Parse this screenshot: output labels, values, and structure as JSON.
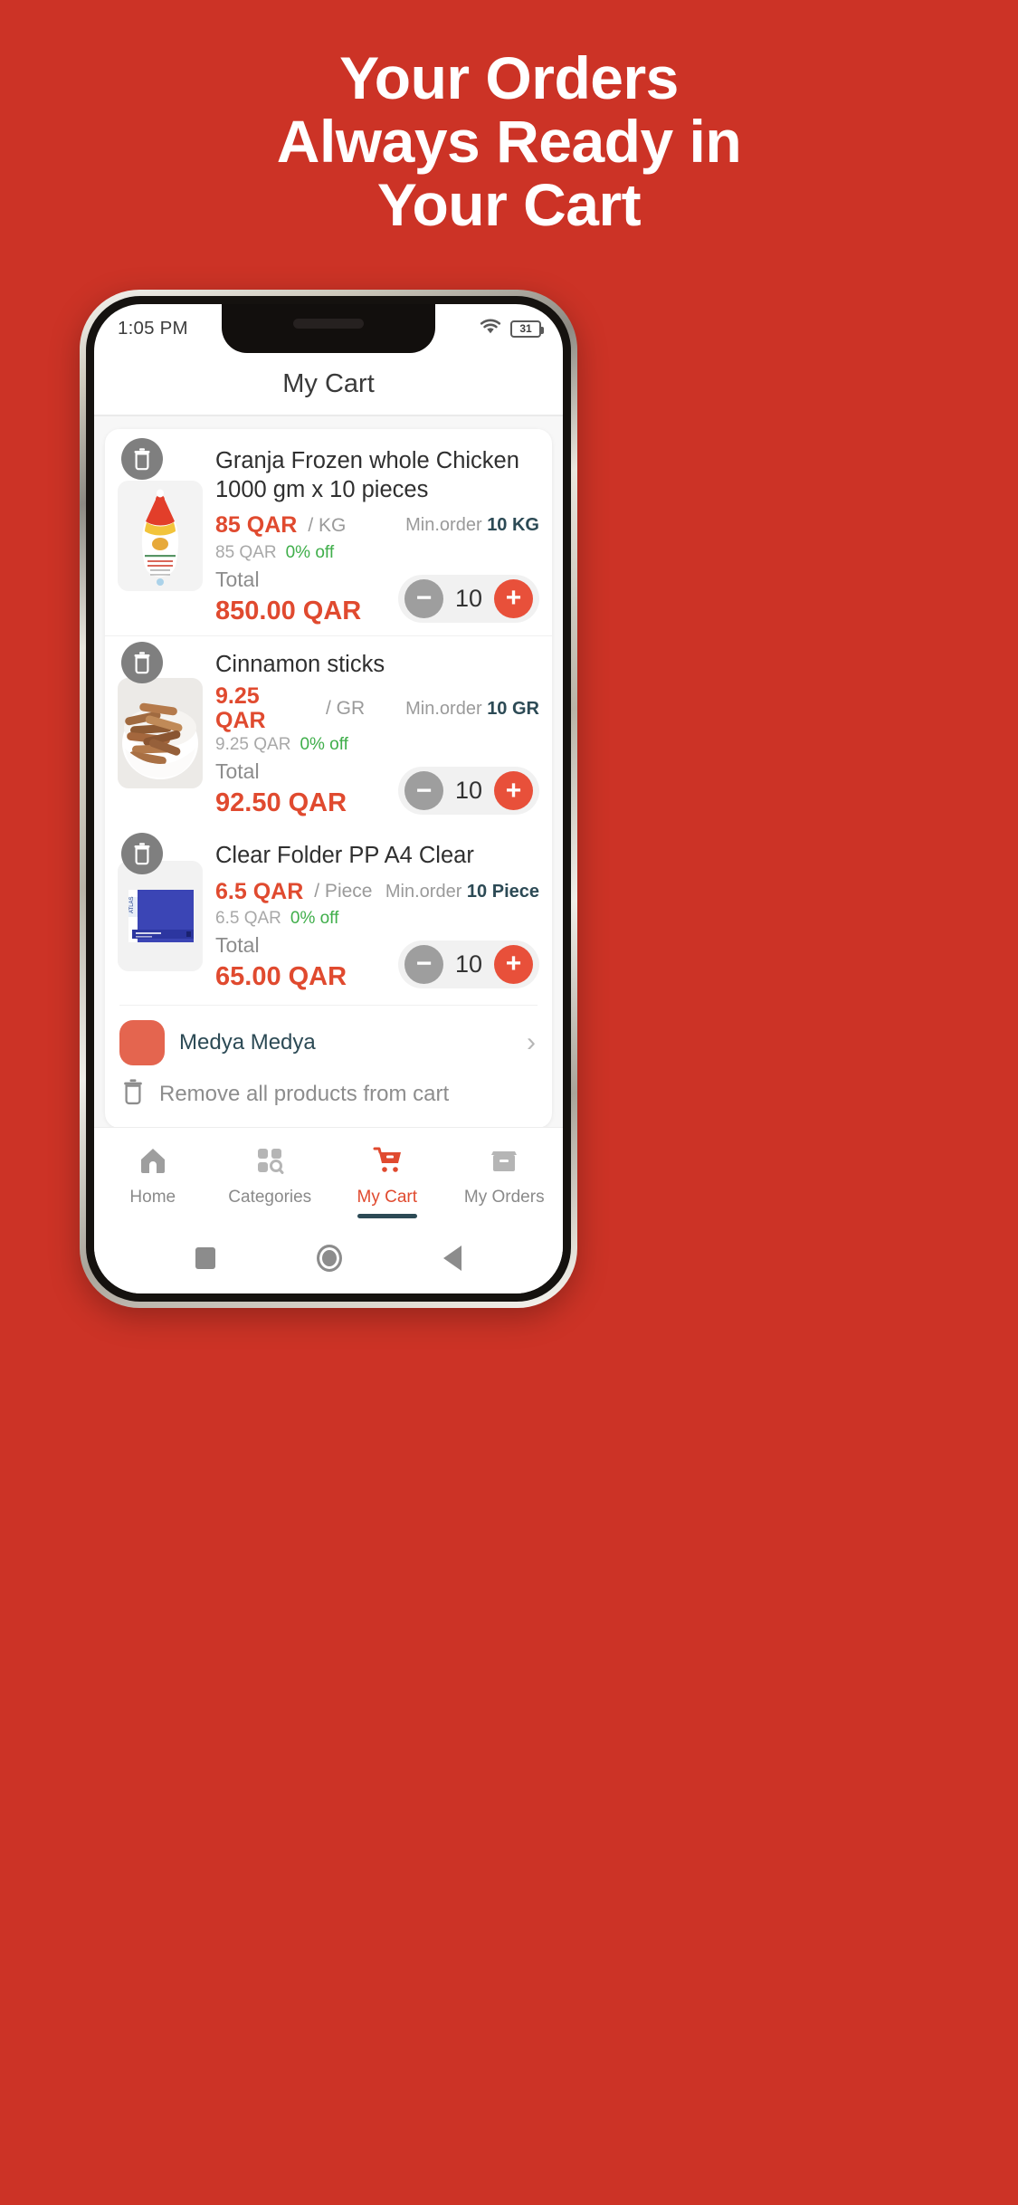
{
  "promo": {
    "line1": "Your Orders",
    "line2": "Always Ready in",
    "line3": "Your Cart"
  },
  "colors": {
    "background_red": "#CC3326",
    "accent_orange": "#E04A2F",
    "plus_button": "#E8503A",
    "minus_button": "#9E9E9E",
    "discount_green": "#3FAE4A",
    "teal_text": "#2C4A55",
    "delete_badge_gray": "#7F7F7F"
  },
  "status_bar": {
    "time": "1:05 PM",
    "wifi_icon": "wifi-icon",
    "battery_icon": "battery-icon",
    "battery_level": "31"
  },
  "header": {
    "title": "My Cart"
  },
  "cart": {
    "products": [
      {
        "name": "Granja Frozen whole Chicken 1000 gm x 10 pieces",
        "price": "85 QAR",
        "unit": "/ KG",
        "min_order_label": "Min.order",
        "min_order_value": "10 KG",
        "old_price": "85 QAR",
        "discount": "0% off",
        "total_label": "Total",
        "total_value": "850.00 QAR",
        "quantity": "10",
        "delete_icon": "trash-icon",
        "image_alt": "granja-frozen-chicken-image"
      },
      {
        "name": "Cinnamon sticks",
        "price": "9.25 QAR",
        "unit": "/ GR",
        "min_order_label": "Min.order",
        "min_order_value": "10 GR",
        "old_price": "9.25 QAR",
        "discount": "0% off",
        "total_label": "Total",
        "total_value": "92.50 QAR",
        "quantity": "10",
        "delete_icon": "trash-icon",
        "image_alt": "cinnamon-sticks-image"
      },
      {
        "name": "Clear Folder PP A4 Clear",
        "price": "6.5 QAR",
        "unit": "/ Piece",
        "min_order_label": "Min.order",
        "min_order_value": "10 Piece",
        "old_price": "6.5 QAR",
        "discount": "0% off",
        "total_label": "Total",
        "total_value": "65.00 QAR",
        "quantity": "10",
        "delete_icon": "trash-icon",
        "image_alt": "clear-folder-pp-a4-image"
      }
    ],
    "seller": {
      "name": "Medya Medya",
      "chevron": "›"
    },
    "remove_all": {
      "label": "Remove all products from cart",
      "icon": "trash-icon"
    }
  },
  "stepper": {
    "minus_symbol": "−",
    "plus_symbol": "+"
  },
  "tabbar": {
    "items": [
      {
        "label": "Home",
        "icon": "home-icon",
        "active": false
      },
      {
        "label": "Categories",
        "icon": "grid-search-icon",
        "active": false
      },
      {
        "label": "My Cart",
        "icon": "shopping-cart-icon",
        "active": true
      },
      {
        "label": "My Orders",
        "icon": "box-icon",
        "active": false
      }
    ]
  },
  "android_nav": {
    "recents": "square-icon",
    "home": "circle-icon",
    "back": "triangle-back-icon"
  }
}
